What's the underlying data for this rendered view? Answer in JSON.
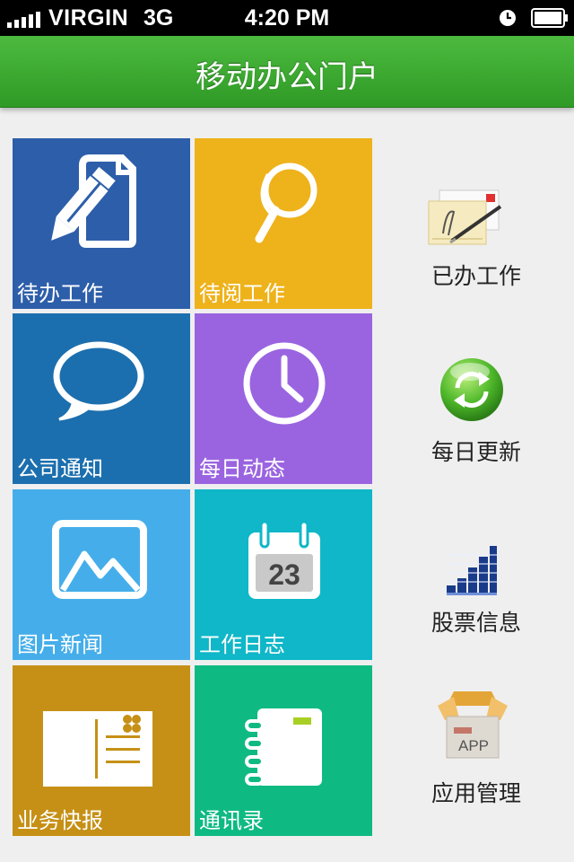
{
  "status_bar": {
    "carrier": "VIRGIN",
    "network": "3G",
    "time": "4:20 PM"
  },
  "header": {
    "title": "移动办公门户"
  },
  "tiles": [
    {
      "label": "待办工作",
      "icon": "pencil-document-icon",
      "color": "#2d5ea9"
    },
    {
      "label": "待阅工作",
      "icon": "magnifier-icon",
      "color": "#eeb21a"
    },
    {
      "label": "公司通知",
      "icon": "speech-bubble-icon",
      "color": "#1c6fae"
    },
    {
      "label": "每日动态",
      "icon": "clock-icon",
      "color": "#9a64e0"
    },
    {
      "label": "图片新闻",
      "icon": "picture-icon",
      "color": "#45aeea"
    },
    {
      "label": "工作日志",
      "icon": "calendar-icon",
      "color": "#0fb7c8"
    },
    {
      "label": "业务快报",
      "icon": "postcard-icon",
      "color": "#c69016"
    },
    {
      "label": "通讯录",
      "icon": "address-book-icon",
      "color": "#0fba82"
    }
  ],
  "calendar_day": "23",
  "side_items": [
    {
      "label": "已办工作",
      "icon": "signed-letter-icon"
    },
    {
      "label": "每日更新",
      "icon": "green-refresh-icon"
    },
    {
      "label": "股票信息",
      "icon": "stock-bars-icon"
    },
    {
      "label": "应用管理",
      "icon": "app-box-icon"
    }
  ],
  "app_box_text": "APP"
}
